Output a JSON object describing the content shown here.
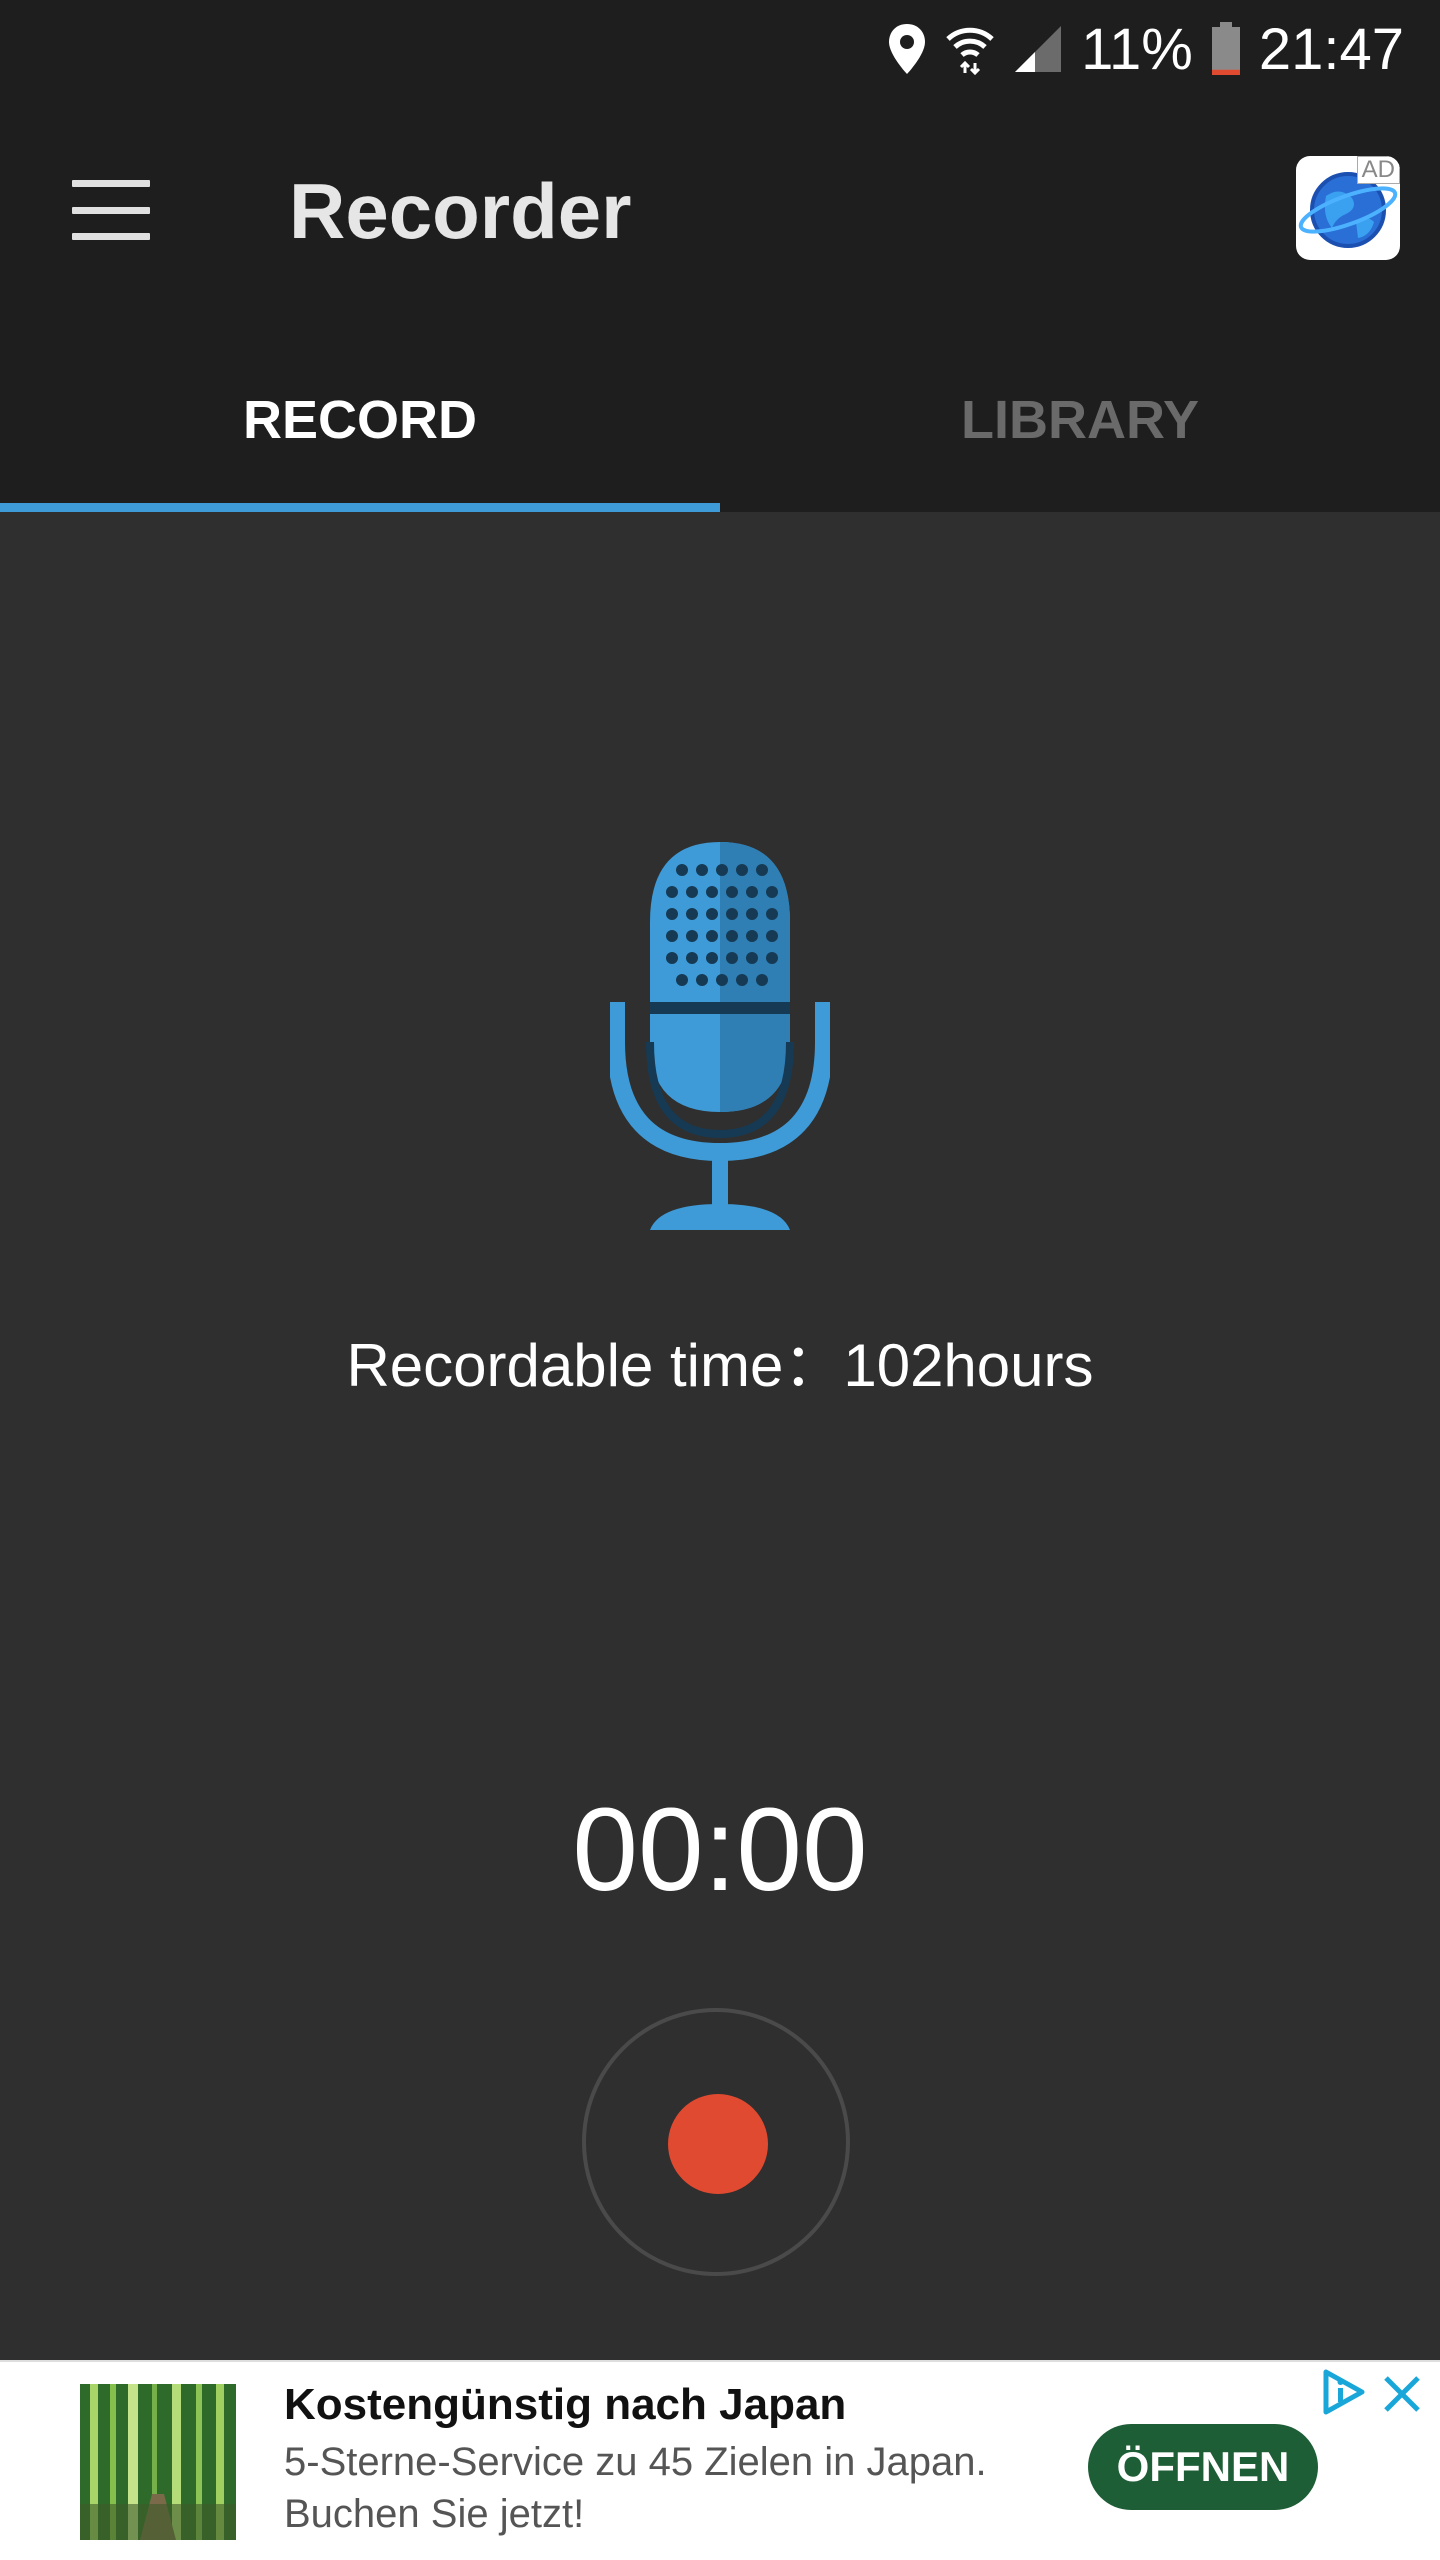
{
  "status_bar": {
    "battery_percent": "11%",
    "time": "21:47",
    "icons": [
      "location-icon",
      "wifi-icon",
      "signal-icon",
      "battery-icon"
    ],
    "battery_level": 0.11,
    "battery_low_color": "#e04a30"
  },
  "app_bar": {
    "title": "Recorder",
    "menu_icon": "hamburger-menu-icon",
    "ad_app_icon": "globe-icon",
    "ad_tag": "AD"
  },
  "tabs": [
    {
      "label": "RECORD",
      "active": true
    },
    {
      "label": "LIBRARY",
      "active": false
    }
  ],
  "main": {
    "mic_icon": "microphone-icon",
    "recordable_time": "Recordable time：102hours",
    "timer": "00:00",
    "record_button_icon": "record-dot-icon"
  },
  "ad_banner": {
    "headline": "Kostengünstig nach Japan",
    "line1": "5-Sterne-Service zu 45 Zielen in Japan.",
    "line2": "Buchen Sie jetzt!",
    "cta": "ÖFFNEN",
    "adchoices_icon": "adchoices-icon",
    "close_icon": "close-icon"
  },
  "colors": {
    "accent": "#3e9bd8",
    "background": "#2f2f2f",
    "bar": "#1e1e1e",
    "record": "#e04a30",
    "cta": "#1e5e36"
  }
}
